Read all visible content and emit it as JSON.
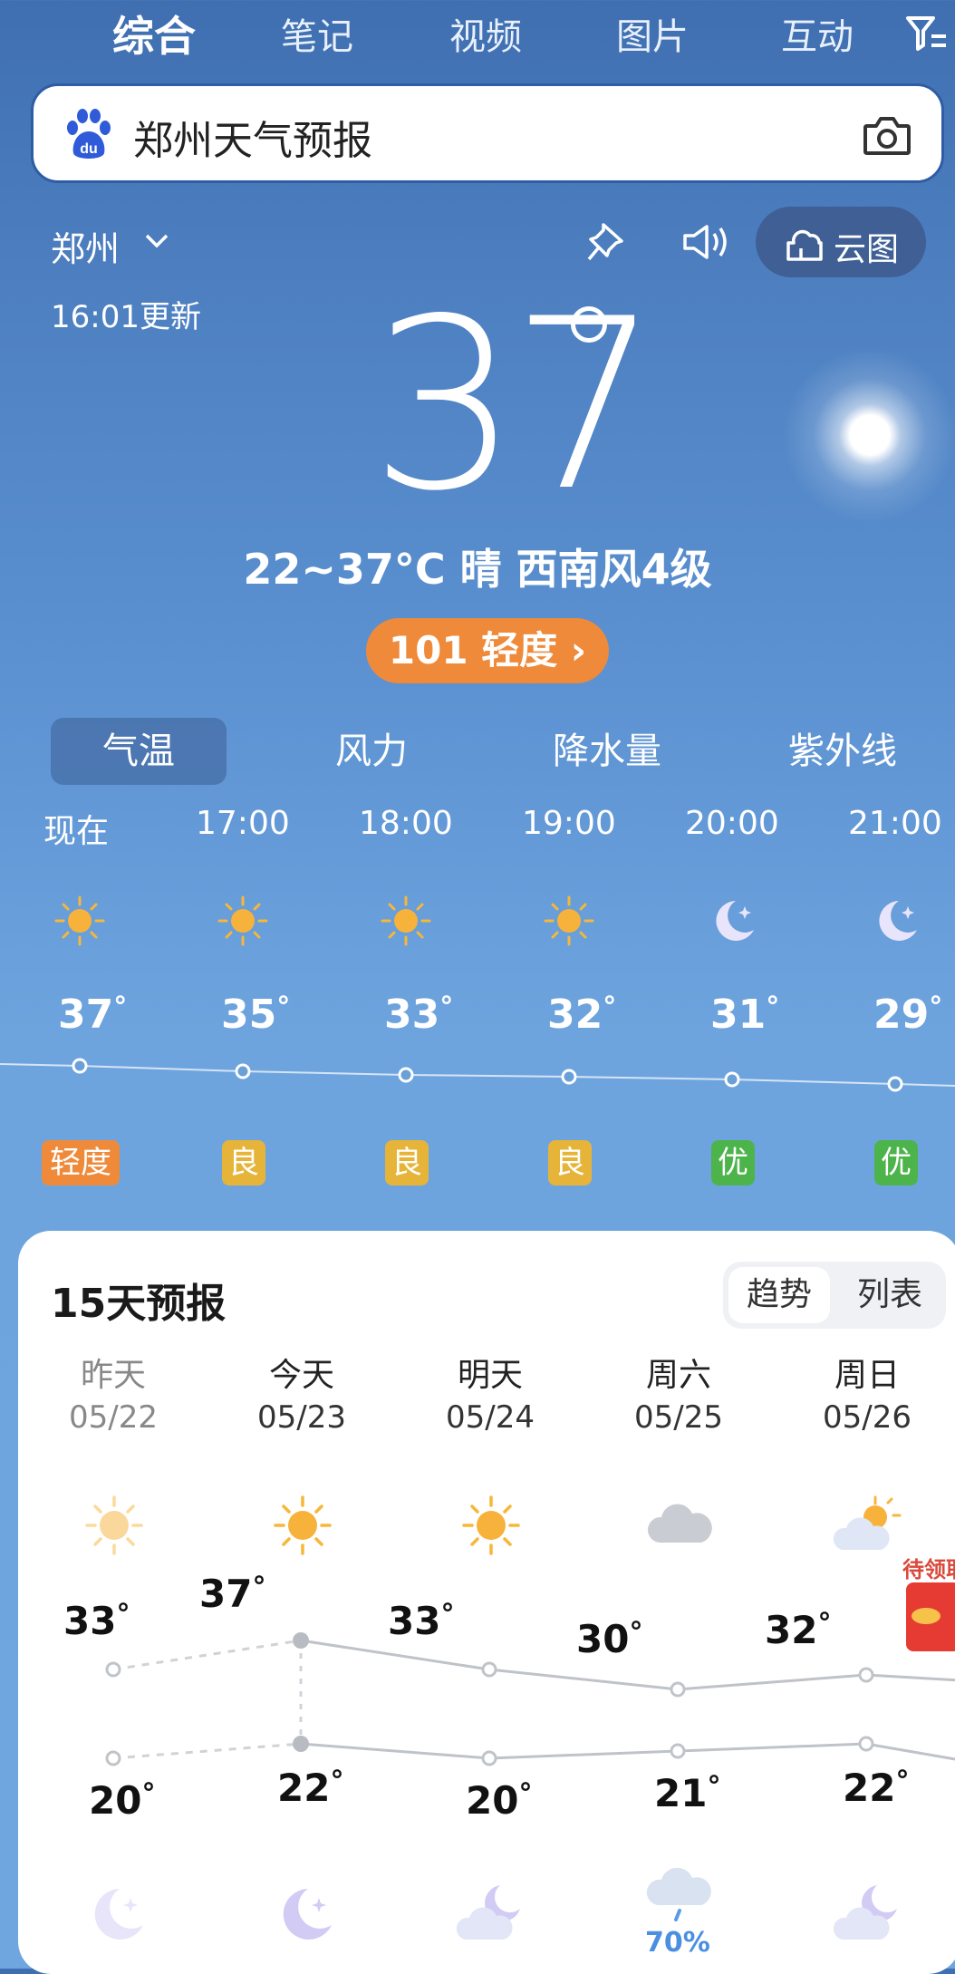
{
  "topnav": {
    "tabs": [
      "综合",
      "笔记",
      "视频",
      "图片",
      "互动"
    ]
  },
  "search": {
    "query": "郑州天气预报"
  },
  "city": "郑州",
  "updated": "16:01更新",
  "cloud_button": "云图",
  "current": {
    "temp": "37",
    "summary": "22~37°C 晴 西南风4级",
    "aqi": "101 轻度 ›"
  },
  "metric_tabs": [
    "气温",
    "风力",
    "降水量",
    "紫外线"
  ],
  "hourly": [
    {
      "time": "现在",
      "temp": "37",
      "icon": "sun-icon",
      "aq": "轻度",
      "aq_color": "#ef8a3a"
    },
    {
      "time": "17:00",
      "temp": "35",
      "icon": "sun-icon",
      "aq": "良",
      "aq_color": "#e7b43a"
    },
    {
      "time": "18:00",
      "temp": "33",
      "icon": "sun-icon",
      "aq": "良",
      "aq_color": "#e7b43a"
    },
    {
      "time": "19:00",
      "temp": "32",
      "icon": "sun-icon",
      "aq": "良",
      "aq_color": "#e7b43a"
    },
    {
      "time": "20:00",
      "temp": "31",
      "icon": "moon-icon",
      "aq": "优",
      "aq_color": "#4cb44a"
    },
    {
      "time": "21:00",
      "temp": "29",
      "icon": "moon-icon",
      "aq": "优",
      "aq_color": "#4cb44a"
    }
  ],
  "forecast": {
    "title": "15天预报",
    "toggle": [
      "趋势",
      "列表"
    ],
    "days": [
      {
        "name": "昨天",
        "date": "05/22",
        "icon": "sun-icon",
        "hi": "33",
        "lo": "20",
        "night_icon": "moon-icon"
      },
      {
        "name": "今天",
        "date": "05/23",
        "icon": "sun-icon",
        "hi": "37",
        "lo": "22",
        "night_icon": "moon-icon"
      },
      {
        "name": "明天",
        "date": "05/24",
        "icon": "sun-icon",
        "hi": "33",
        "lo": "20",
        "night_icon": "cloud-moon-icon"
      },
      {
        "name": "周六",
        "date": "05/25",
        "icon": "cloud-icon",
        "hi": "30",
        "lo": "21",
        "night_icon": "rain-cloud-icon",
        "precip": "70%"
      },
      {
        "name": "周日",
        "date": "05/26",
        "icon": "partly-cloudy-icon",
        "hi": "32",
        "lo": "22",
        "night_icon": "cloud-moon-icon"
      }
    ],
    "promo": "待领取"
  },
  "colors": {
    "aqi_orange": "#ef8a3a",
    "aq_good": "#e7b43a",
    "aq_excellent": "#4cb44a",
    "red_packet": "#e63b33"
  }
}
